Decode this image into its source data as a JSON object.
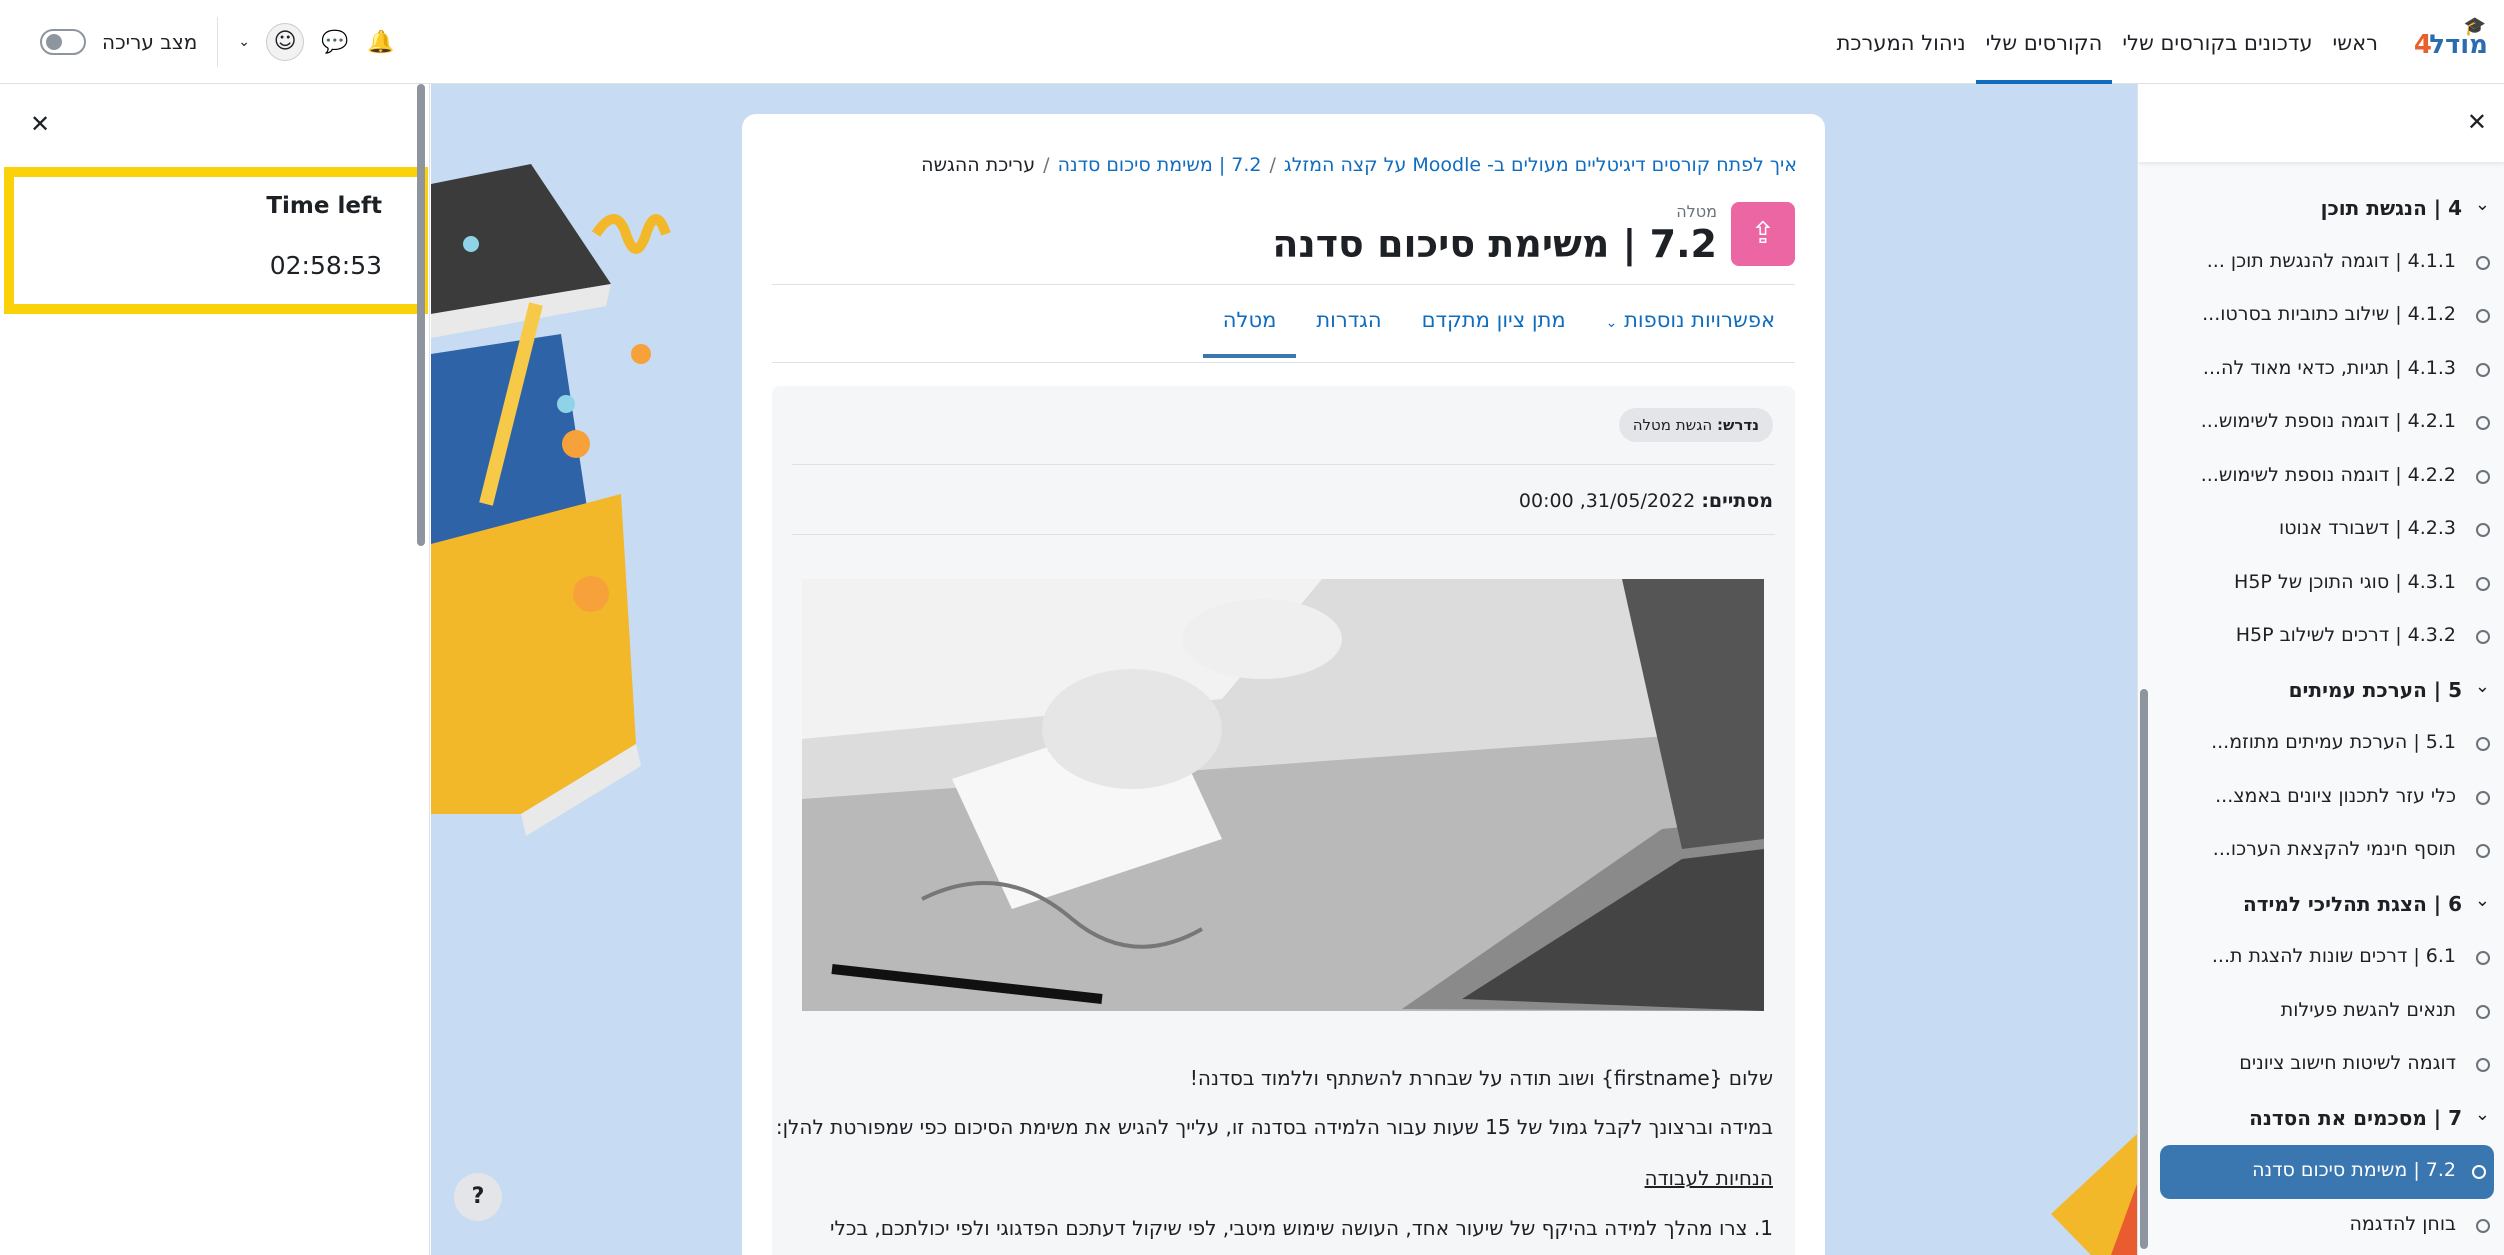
{
  "navbar": {
    "logo_text": "מודל",
    "logo_number": "4",
    "items": [
      {
        "label": "ראשי"
      },
      {
        "label": "עדכונים בקורסים שלי"
      },
      {
        "label": "הקורסים שלי"
      },
      {
        "label": "ניהול המערכת"
      }
    ],
    "edit_mode_label": "מצב עריכה"
  },
  "timer": {
    "title": "Time left",
    "value": "02:58:53"
  },
  "course_index": [
    {
      "type": "section",
      "label": "4 | הנגשת תוכן"
    },
    {
      "type": "item",
      "label": "4.1.1 | דוגמה להנגשת תוכן ..."
    },
    {
      "type": "item",
      "label": "4.1.2 | שילוב כתוביות בסרטו..."
    },
    {
      "type": "item",
      "label": "4.1.3 | תגיות, כדאי מאוד לה..."
    },
    {
      "type": "item",
      "label": "4.2.1 | דוגמה נוספת לשימוש..."
    },
    {
      "type": "item",
      "label": "4.2.2 | דוגמה נוספת לשימוש..."
    },
    {
      "type": "item",
      "label": "4.2.3 | דשבורד אנוטו"
    },
    {
      "type": "item",
      "label": "4.3.1 | סוגי התוכן של H5P"
    },
    {
      "type": "item",
      "label": "4.3.2 | דרכים לשילוב H5P"
    },
    {
      "type": "section",
      "label": "5 | הערכת עמיתים"
    },
    {
      "type": "item",
      "label": "5.1 | הערכת עמיתים מתוזמ..."
    },
    {
      "type": "item",
      "label": "כלי עזר לתכנון ציונים באמצ..."
    },
    {
      "type": "item",
      "label": "תוסף חינמי להקצאת הערכו..."
    },
    {
      "type": "section",
      "label": "6 | הצגת תהליכי למידה"
    },
    {
      "type": "item",
      "label": "6.1 | דרכים שונות להצגת ת..."
    },
    {
      "type": "item",
      "label": "תנאים להגשת פעילות"
    },
    {
      "type": "item",
      "label": "דוגמה לשיטות חישוב ציונים"
    },
    {
      "type": "section",
      "label": "7 | מסכמים את הסדנה"
    },
    {
      "type": "active",
      "label": "7.2 | משימת סיכום סדנה"
    },
    {
      "type": "item",
      "label": "בוחן להדגמה"
    }
  ],
  "breadcrumb": {
    "course": "איך לפתח קורסים דיגיטליים מעולים ב- Moodle על קצה המזלג",
    "activity": "7.2 | משימת סיכום סדנה",
    "current": "עריכת ההגשה"
  },
  "activity": {
    "type_label": "מטלה",
    "title": "7.2 | משימת סיכום סדנה",
    "icon_color": "#eb66a2"
  },
  "tabs": [
    {
      "label": "מטלה"
    },
    {
      "label": "הגדרות"
    },
    {
      "label": "מתן ציון מתקדם"
    },
    {
      "label": "אפשרויות נוספות"
    }
  ],
  "requirement": {
    "prefix": "נדרש:",
    "text": "הגשת מטלה"
  },
  "due": {
    "label": "מסתיים:",
    "value": "31/05/2022, 00:00"
  },
  "body": {
    "greeting": "שלום {firstname} ושוב תודה על שבחרת להשתתף וללמוד בסדנה!",
    "intro": "במידה וברצונך לקבל גמול של 15 שעות עבור הלמידה בסדנה זו, עלייך להגיש את משימת הסיכום כפי שמפורטת להלן:",
    "instructions_heading": "הנחיות לעבודה",
    "item1": "1. צרו מהלך למידה בהיקף של שיעור אחד, העושה שימוש מיטבי, לפי שיקול דעתכם הפדגוגי ולפי יכולתכם, בכלי"
  },
  "colors": {
    "accent": "#0f6cbf",
    "active_item": "#3a77b0",
    "timer_border": "#fbd10a",
    "main_bg": "#c7dcf2"
  },
  "help_label": "?"
}
